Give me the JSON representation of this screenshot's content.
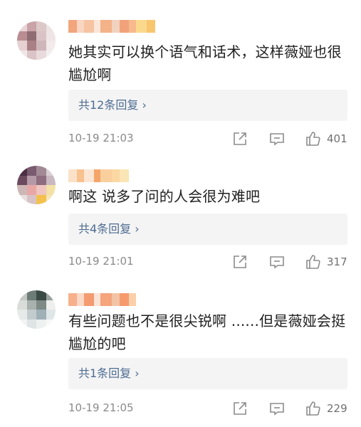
{
  "comments": [
    {
      "text": "她其实可以换个语气和话术，这样薇娅也很尴尬啊",
      "reply_link": "共12条回复 ›",
      "time": "10-19 21:03",
      "likes": "401",
      "avatar_colors": [
        "#e7d4d6",
        "#c9a3a8",
        "#dcc8c7",
        "#ede3e3",
        "#b98d92",
        "#8f6d73",
        "#d9c3c6",
        "#efe5e6",
        "#e6d0d2",
        "#a98086",
        "#cfb6ba",
        "#f2eaeb",
        "#f0e6e7",
        "#dbc4c7",
        "#e9dadc",
        "#f4eeef"
      ],
      "username_colors": [
        "#f3a57d",
        "#f9d6c2",
        "#f6c3a3",
        "#fbe6d9",
        "#f4b288",
        "#f1d1bf",
        "#f2a27a",
        "#f7b98d",
        "#fad98c",
        "#f8c66f"
      ]
    },
    {
      "text": "啊这 说多了问的人会很为难吧",
      "reply_link": "共4条回复 ›",
      "time": "10-19 21:01",
      "likes": "317",
      "avatar_colors": [
        "#4b2f45",
        "#7a5a6e",
        "#a18a95",
        "#d9cfd4",
        "#6b4a5e",
        "#b49aa7",
        "#8d6d7f",
        "#c9b8c0",
        "#ccb6b6",
        "#e8a7a5",
        "#f0c5c0",
        "#f3e1a5",
        "#e9dede",
        "#d7c3c6",
        "#f2c14e",
        "#f5e6b9"
      ],
      "username_colors": [
        "#fbe1c8",
        "#f8c18f",
        "#fce6d3",
        "#f6a56a",
        "#f9cf9e",
        "#fbd7a1",
        "#fae5b5"
      ]
    },
    {
      "text": "有些问题也不是很尖锐啊 ......但是薇娅会挺尴尬的吧",
      "reply_link": "共1条回复 ›",
      "time": "10-19 21:05",
      "likes": "229",
      "avatar_colors": [
        "#c3c8c4",
        "#6e7c77",
        "#3c4a46",
        "#9aa39f",
        "#d9ddd9",
        "#a8b1ad",
        "#7d8a85",
        "#eef0ee",
        "#e6ebea",
        "#c2cccf",
        "#9fb0b6",
        "#dfe6e8",
        "#f2f4f3",
        "#dfe5e6",
        "#eef1f1",
        "#f7f8f8"
      ],
      "username_colors": [
        "#f7b08c",
        "#fcd9c6",
        "#f49b72",
        "#fbe4d6",
        "#f5a47c",
        "#f2c3a5",
        "#f69a6d",
        "#fbd0a8"
      ]
    }
  ],
  "icons": {
    "share": "share-box-icon",
    "reply": "comment-bubble-icon",
    "like": "thumbs-up-icon"
  }
}
